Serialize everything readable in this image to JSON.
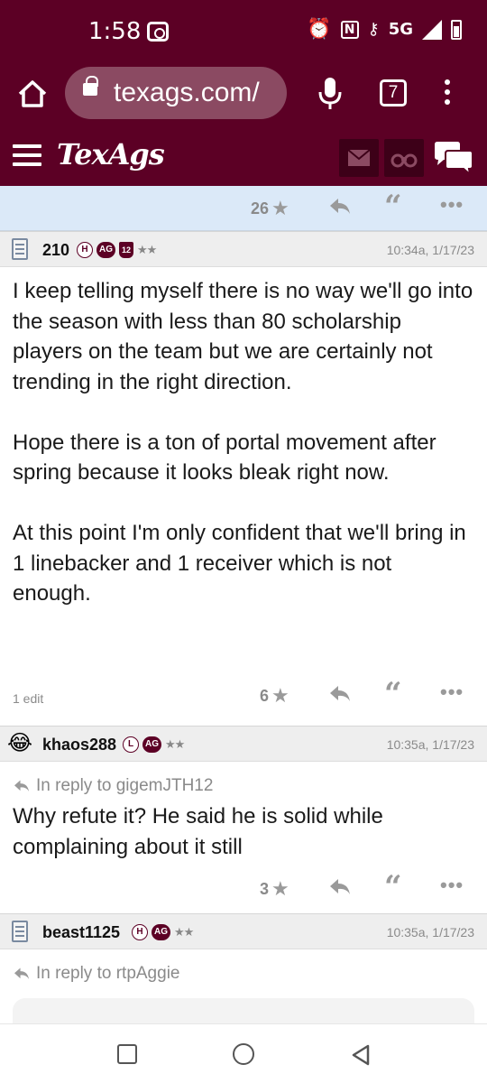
{
  "status_bar": {
    "time": "1:58",
    "network": "5G"
  },
  "browser": {
    "url": "texags.com/",
    "tab_count": "7"
  },
  "site": {
    "logo": "TexAgs"
  },
  "top_post_footer": {
    "star_count": "26"
  },
  "posts": [
    {
      "username": "210",
      "badges": [
        "H",
        "AG",
        "12"
      ],
      "stars": "★★",
      "timestamp": "10:34a, 1/17/23",
      "paragraphs": [
        "I keep telling myself there is no way we'll go into the season with less than 80 scholarship players on the team but we are certainly not trending in the right direction.",
        "Hope there is a ton of portal movement after spring because it looks bleak right now.",
        "At this point I'm only confident that we'll bring in 1 linebacker and 1 receiver which is not enough."
      ],
      "edit_note": "1 edit",
      "star_count": "6"
    },
    {
      "username": "khaos288",
      "badges": [
        "L",
        "AG"
      ],
      "stars": "★★",
      "timestamp": "10:35a, 1/17/23",
      "reply_to": "In reply to gigemJTH12",
      "paragraphs": [
        "Why refute it? He said he is solid while complaining about it still"
      ],
      "star_count": "3"
    },
    {
      "username": "beast1125",
      "badges": [
        "H",
        "AG"
      ],
      "stars": "★★",
      "timestamp": "10:35a, 1/17/23",
      "reply_to": "In reply to rtpAggie"
    }
  ],
  "icons": {
    "home": "home-icon",
    "lock": "lock-icon",
    "mic": "microphone-icon",
    "menu": "hamburger-menu-icon",
    "mail": "mail-icon",
    "binoculars": "binoculars-icon",
    "chat": "chat-bubbles-icon",
    "star": "star-icon",
    "reply": "reply-arrow-icon",
    "quote": "quote-icon",
    "more": "more-dots-icon"
  },
  "colors": {
    "brand": "#5c0025",
    "header_bg": "#eeeeee",
    "highlight_bg": "#dbe9f8"
  }
}
